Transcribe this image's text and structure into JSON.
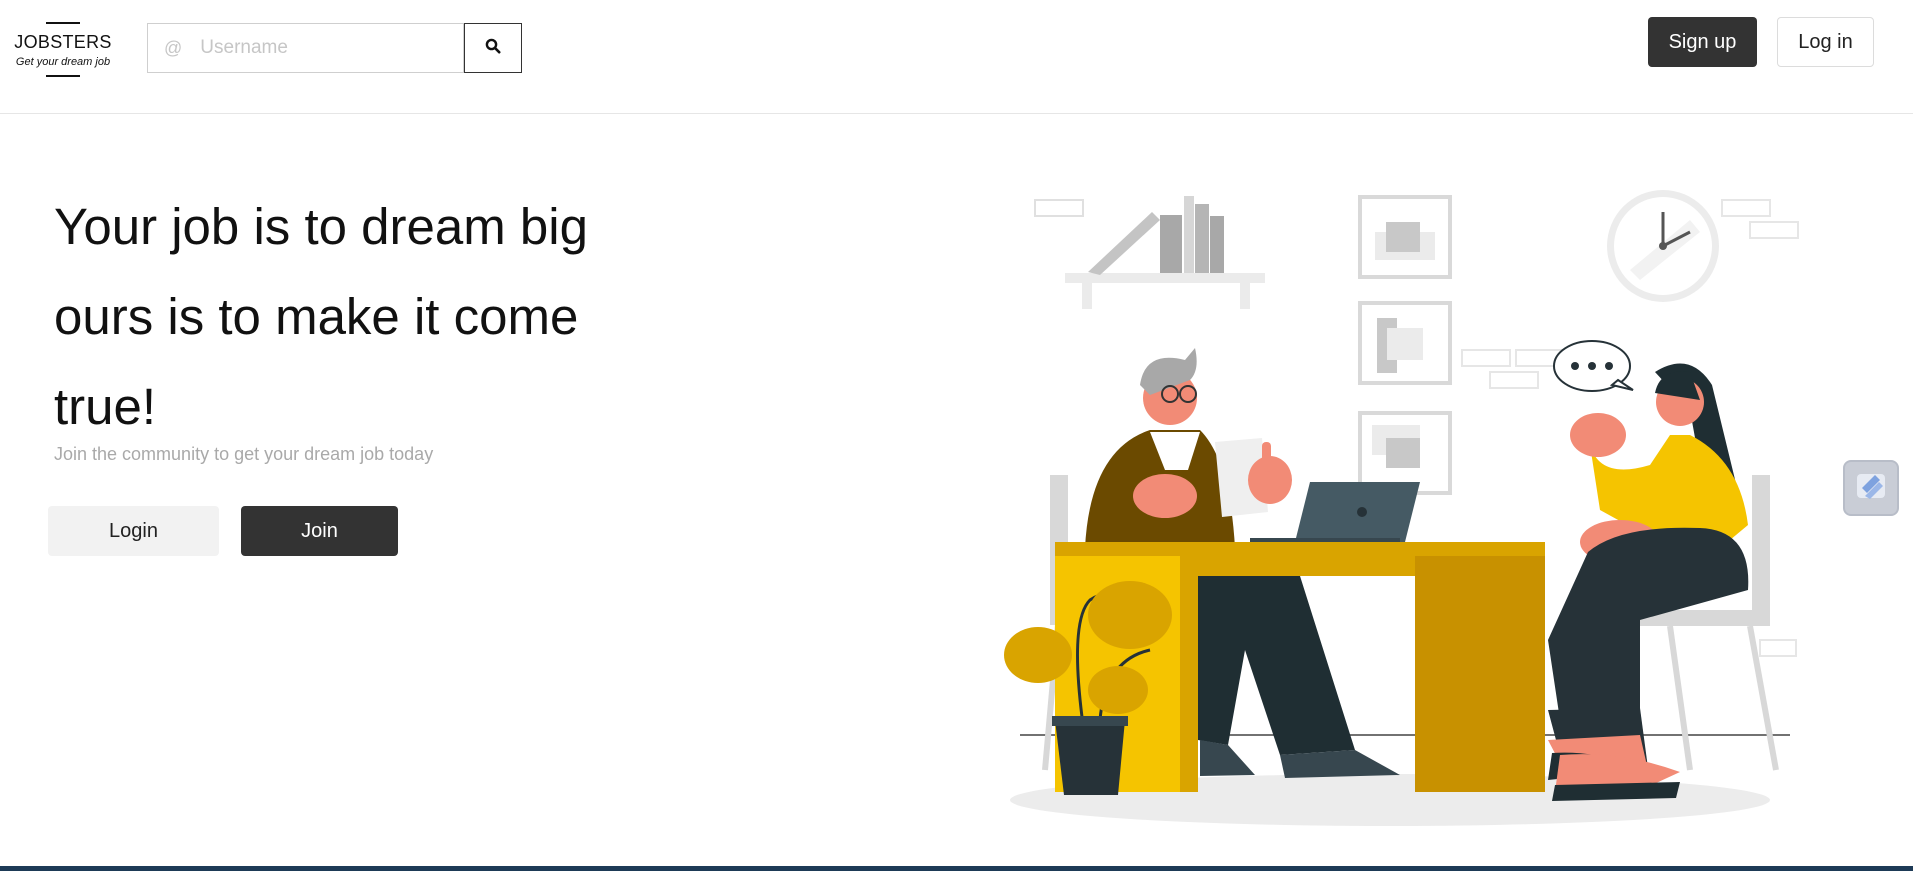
{
  "brand": {
    "name": "JOBSTERS",
    "tagline": "Get your dream job"
  },
  "search": {
    "prefix": "@",
    "placeholder": "Username",
    "icon": "search-icon"
  },
  "nav": {
    "signup_label": "Sign up",
    "login_label": "Log in"
  },
  "hero": {
    "title_lines": [
      "Your job is to dream big",
      "ours is to make it come",
      "true!"
    ],
    "subtitle": "Join the community to get your dream job today",
    "login_label": "Login",
    "join_label": "Join"
  },
  "colors": {
    "dark_button": "#333333",
    "accent_yellow": "#F5C400",
    "ink_dark": "#263238",
    "bottom_bar": "#1D3A56"
  },
  "illustration": "job-interview-illustration",
  "widget_icon": "floating-widget-icon"
}
